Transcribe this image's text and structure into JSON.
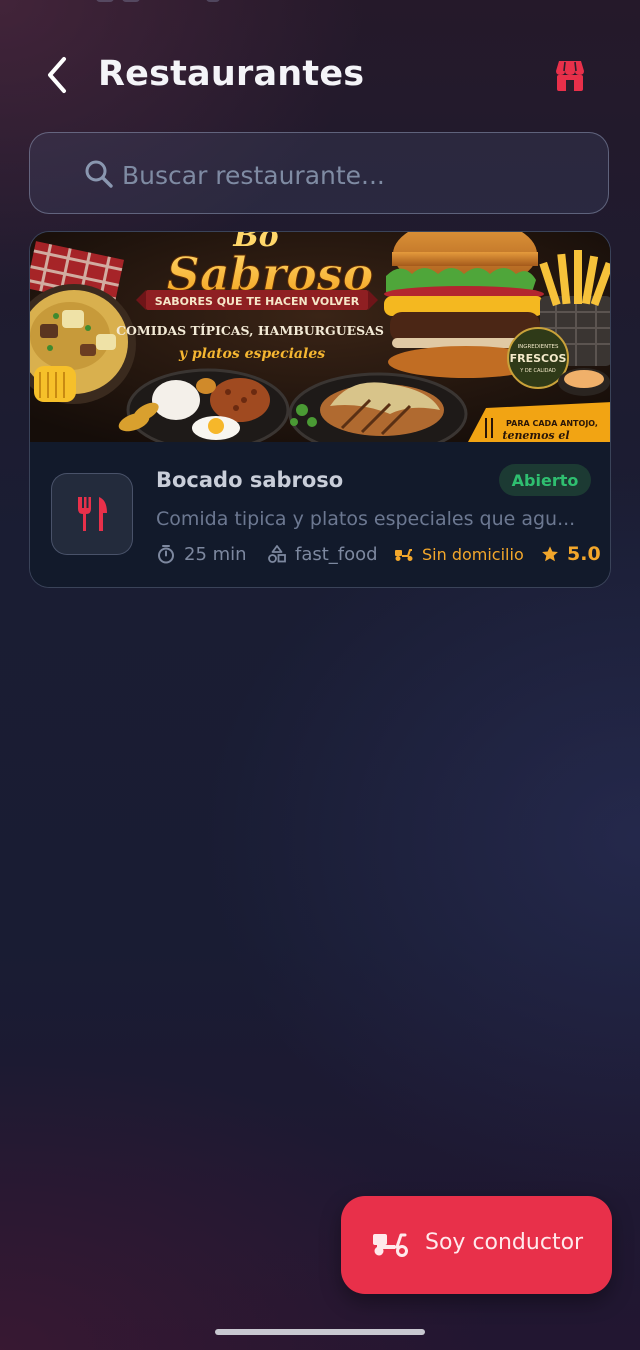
{
  "header": {
    "title": "Restaurantes",
    "back_icon": "chevron-left-icon",
    "store_icon": "storefront-icon"
  },
  "search": {
    "placeholder": "Buscar restaurante...",
    "value": "",
    "icon": "search-icon"
  },
  "restaurants": [
    {
      "name": "Bocado sabroso",
      "status": "Abierto",
      "description": "Comida tipica y platos especiales que agu...",
      "time": "25 min",
      "category": "fast_food",
      "delivery": "Sin domicilio",
      "rating": "5.0",
      "logo_icon": "fork-knife-icon",
      "banner": {
        "headline": "Sabroso",
        "tagline": "SABORES QUE TE HACEN VOLVER",
        "subtitle": "COMIDAS TÍPICAS, HAMBURGUESAS",
        "subtitle2": "y platos especiales",
        "seal_line1": "INGREDIENTES",
        "seal_line2": "FRESCOS",
        "seal_line3": "Y DE CALIDAD",
        "corner_line1": "PARA CADA ANTOJO,",
        "corner_line2": "tenemos el"
      }
    }
  ],
  "fab": {
    "label": "Soy conductor",
    "icon": "scooter-icon"
  },
  "colors": {
    "accent": "#e8304a",
    "open_green": "#2fbf70",
    "gold": "#f3a72b"
  }
}
